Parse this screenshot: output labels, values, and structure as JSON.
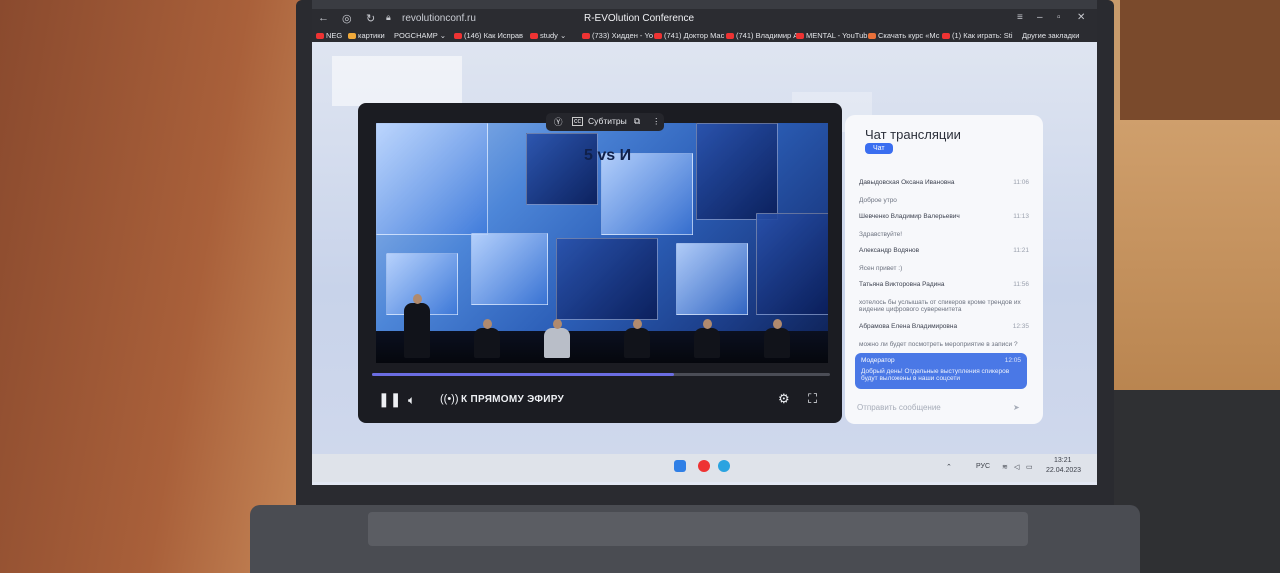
{
  "browser": {
    "url": "revolutionconf.ru",
    "title": "R-EVOlution Conference",
    "bookmarks": [
      "NEG",
      "картики",
      "POGCHAMP",
      "(146) Как Исправ",
      "study",
      "(733) Хидден - Yo",
      "(741) Доктор Мас",
      "(741) Владимир А",
      "MENTAL - YouTub",
      "Скачать курс «Мс",
      "(1) Как играть: Sti"
    ],
    "other_bookmarks": "Другие закладки"
  },
  "player": {
    "subtitles_label": "Субтитры",
    "live_label": "К ПРЯМОМУ ЭФИРУ",
    "video_text": "5 vs И",
    "progress": 0.66
  },
  "chat": {
    "title": "Чат трансляции",
    "tab": "Чат",
    "messages": [
      {
        "author": "Давыдовская Оксана Ивановна",
        "time": "11:06",
        "text": "Доброе утро"
      },
      {
        "author": "Шевченко Владимир Валерьевич",
        "time": "11:13",
        "text": "Здравствуйте!"
      },
      {
        "author": "Александр Водянов",
        "time": "11:21",
        "text": "Ясен привет :)"
      },
      {
        "author": "Татьяна Викторовна Радина",
        "time": "11:56",
        "text": "хотелось бы услышать от спикеров кроме трендов их видение цифрового суверенитета"
      },
      {
        "author": "Абрамова Елена Владимировна",
        "time": "12:35",
        "text": "можно ли будет посмотреть мероприятие в записи ?"
      }
    ],
    "moderator": {
      "author": "Модератор",
      "time": "12:05",
      "text": "Добрый день! Отдельные выступления спикеров будут выложены в наши соцсети"
    },
    "input_placeholder": "Отправить сообщение"
  },
  "taskbar": {
    "lang": "РУС",
    "time": "13:21",
    "date": "22.04.2023"
  }
}
